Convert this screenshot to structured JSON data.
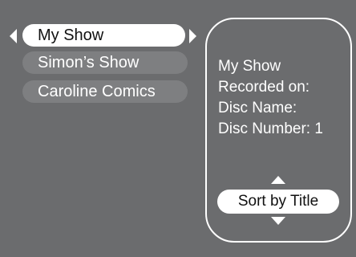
{
  "list": {
    "items": [
      {
        "label": "My Show"
      },
      {
        "label": "Simon’s Show"
      },
      {
        "label": "Caroline Comics"
      }
    ]
  },
  "details": {
    "title": "My Show",
    "recorded_label": "Recorded on:",
    "disc_name_label": "Disc Name:",
    "disc_number_label": "Disc Number: 1"
  },
  "sort": {
    "label": "Sort by Title"
  },
  "icons": {
    "left": "left-arrow-icon",
    "right": "right-arrow-icon",
    "up": "up-arrow-icon",
    "down": "down-arrow-icon"
  },
  "colors": {
    "background": "#6b6c6e",
    "item_inactive": "#7e7f81",
    "highlight": "#ffffff"
  }
}
